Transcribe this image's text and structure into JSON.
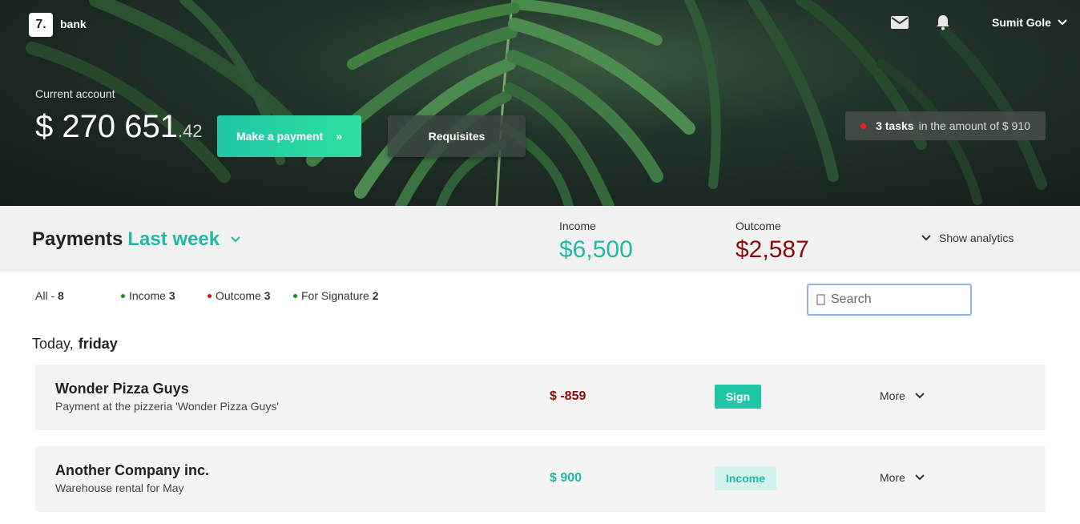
{
  "header": {
    "logo_mark": "7.",
    "logo_text": "bank",
    "user_name": "Sumit Gole",
    "icons": [
      "mail-icon",
      "bell-icon",
      "chevron-down-icon"
    ]
  },
  "account": {
    "label": "Current account",
    "balance_main": "$ 270 651",
    "balance_cents": ".42"
  },
  "actions": {
    "pay_label": "Make a payment",
    "pay_arrow": "»",
    "requisites_label": "Requisites"
  },
  "tasks": {
    "count_text": "3 tasks",
    "amount_text": "in the amount of $ 910"
  },
  "summary": {
    "title": "Payments",
    "period": "Last week",
    "income_label": "Income",
    "income_value": "$6,500",
    "outcome_label": "Outcome",
    "outcome_value": "$2,587",
    "analytics_label": "Show analytics"
  },
  "filters": {
    "all_label": "All - ",
    "all_count": "8",
    "income_label": "Income ",
    "income_count": "3",
    "outcome_label": "Outcome ",
    "outcome_count": "3",
    "signature_label": "For Signature ",
    "signature_count": "2"
  },
  "search": {
    "placeholder": "Search"
  },
  "day": {
    "prefix": "Today,",
    "name": "friday"
  },
  "transactions": [
    {
      "name": "Wonder Pizza Guys",
      "description": "Payment at the pizzeria 'Wonder Pizza Guys'",
      "amount": "$ -859",
      "action": "Sign",
      "more": "More"
    },
    {
      "name": "Another Company inc.",
      "description": "Warehouse rental for May",
      "amount": "$ 900",
      "action": "Income",
      "more": "More"
    }
  ],
  "colors": {
    "accent": "#21b8a6",
    "income": "#21b8a6",
    "outcome": "#8b0a0a",
    "green_dot": "#1a8a1a",
    "red_dot": "#e01010"
  }
}
